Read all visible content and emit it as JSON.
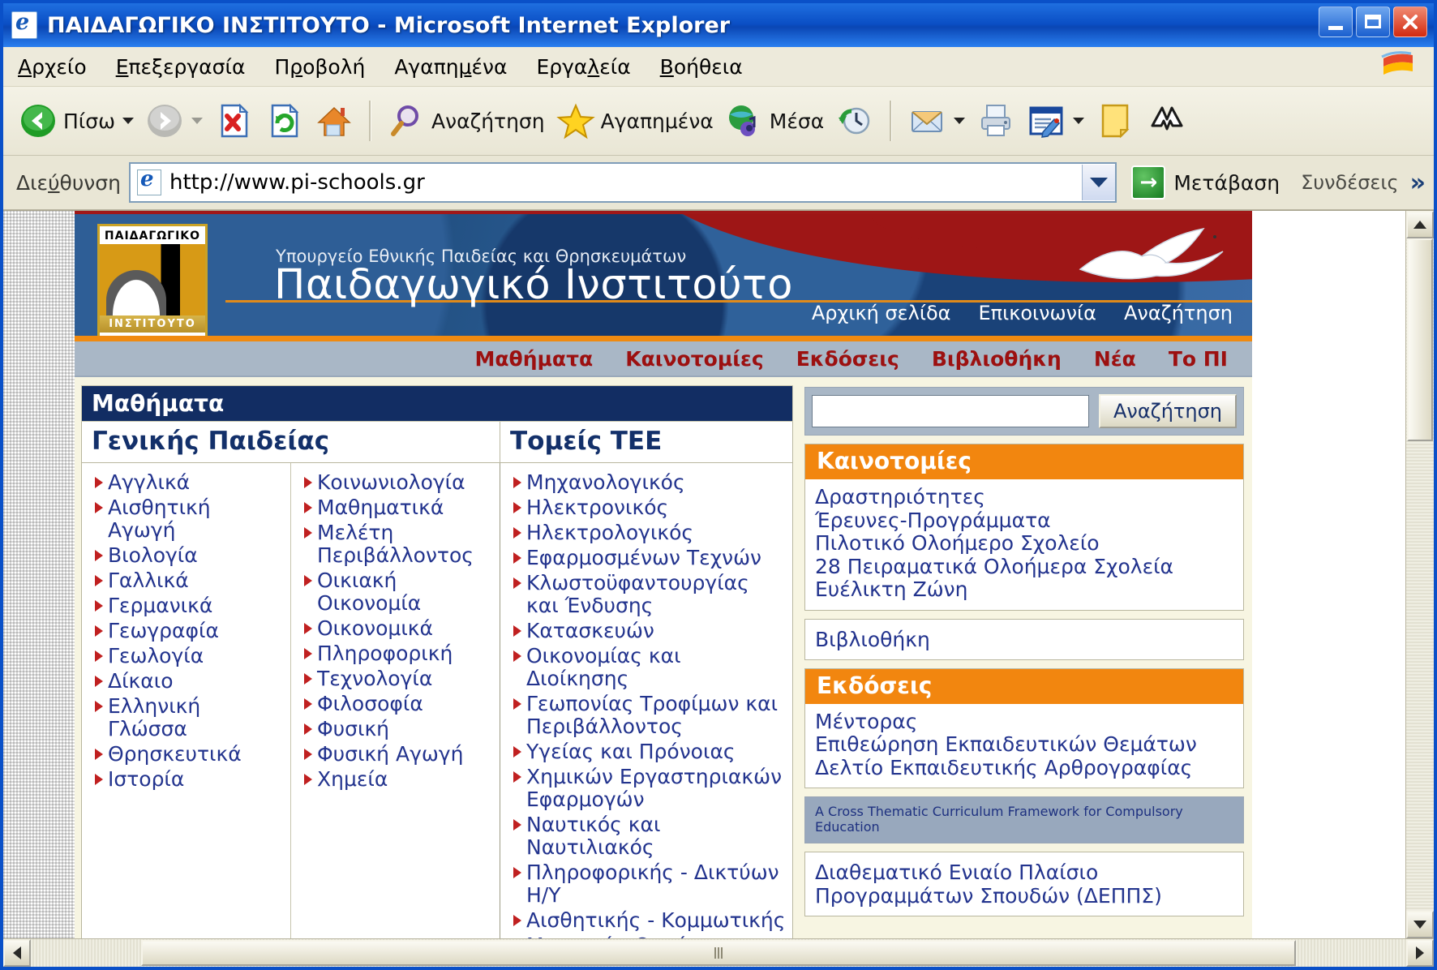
{
  "window": {
    "title": "ΠΑΙΔΑΓΩΓΙΚΟ ΙΝΣΤΙΤΟΥΤΟ - Microsoft Internet Explorer",
    "app_icon": "ie-document-icon",
    "minimize": "–",
    "maximize": "□",
    "close": "✕"
  },
  "menubar": {
    "items": [
      {
        "label": "Αρχείο"
      },
      {
        "label": "Επεξεργασία"
      },
      {
        "label": "Προβολή"
      },
      {
        "label": "Αγαπημένα"
      },
      {
        "label": "Εργαλεία"
      },
      {
        "label": "Βοήθεια"
      }
    ]
  },
  "toolbar": {
    "back_label": "Πίσω",
    "forward_label": "",
    "stop_label": "",
    "refresh_label": "",
    "home_label": "",
    "search_label": "Αναζήτηση",
    "favorites_label": "Αγαπημένα",
    "media_label": "Μέσα",
    "history_label": "",
    "mail_label": "",
    "print_label": "",
    "edit_label": "",
    "notes_label": "",
    "messenger_label": ""
  },
  "address": {
    "label": "Διεύθυνση",
    "url": "http://www.pi-schools.gr",
    "go_label": "Μετάβαση",
    "go_icon": "→",
    "links_label": "Συνδέσεις",
    "more_chevron": "»"
  },
  "site": {
    "logo": {
      "top_text": "ΠΑΙΔΑΓΩΓΙΚΟ",
      "bottom_text": "ΙΝΣΤΙΤΟΥΤΟ"
    },
    "ministry": "Υπουργείο Εθνικής Παιδείας και Θρησκευμάτων",
    "title": "Παιδαγωγικό Ινστιτούτο",
    "topnav": [
      {
        "label": "Αρχική σελίδα"
      },
      {
        "label": "Επικοινωνία"
      },
      {
        "label": "Αναζήτηση"
      }
    ],
    "mainnav": [
      {
        "label": "Μαθήματα"
      },
      {
        "label": "Καινοτομίες"
      },
      {
        "label": "Εκδόσεις"
      },
      {
        "label": "Βιβλιοθήκη"
      },
      {
        "label": "Νέα"
      },
      {
        "label": "Το ΠΙ"
      }
    ]
  },
  "courses": {
    "panel_title": "Μαθήματα",
    "header_general": "Γενικής Παιδείας",
    "header_tee": "Τομείς ΤΕΕ",
    "general_col1": [
      "Αγγλικά",
      "Αισθητική Αγωγή",
      "Βιολογία",
      "Γαλλικά",
      "Γερμανικά",
      "Γεωγραφία",
      "Γεωλογία",
      "Δίκαιο",
      "Ελληνική Γλώσσα",
      "Θρησκευτικά",
      "Ιστορία"
    ],
    "general_col2": [
      "Κοινωνιολογία",
      "Μαθηματικά",
      "Μελέτη Περιβάλλοντος",
      "Οικιακή Οικονομία",
      "Οικονομικά",
      "Πληροφορική",
      "Τεχνολογία",
      "Φιλοσοφία",
      "Φυσική",
      "Φυσική Αγωγή",
      "Χημεία"
    ],
    "tee_col": [
      "Μηχανολογικός",
      "Ηλεκτρονικός",
      "Ηλεκτρολογικός",
      "Εφαρμοσμένων Τεχνών",
      "Κλωστοϋφαντουργίας και Ένδυσης",
      "Κατασκευών",
      "Οικονομίας και Διοίκησης",
      "Γεωπονίας Τροφίμων και Περιβάλλοντος",
      "Υγείας και Πρόνοιας",
      "Χημικών Εργαστηριακών Εφαρμογών",
      "Ναυτικός και Ναυτιλιακός",
      "Πληροφορικής - Δικτύων Η/Υ",
      "Αισθητικής - Κομμωτικής",
      "Μουσικών Οργάνων"
    ]
  },
  "sidebar": {
    "search_value": "",
    "search_button": "Αναζήτηση",
    "innovations": {
      "heading": "Καινοτομίες",
      "links": [
        "Δραστηριότητες",
        "Έρευνες-Προγράμματα",
        "Πιλοτικό Ολοήμερο Σχολείο",
        "28 Πειραματικά Ολοήμερα Σχολεία",
        "Ευέλικτη Ζώνη"
      ]
    },
    "library": {
      "label": "Βιβλιοθήκη"
    },
    "publications": {
      "heading": "Εκδόσεις",
      "links": [
        "Μέντορας",
        "Επιθεώρηση Εκπαιδευτικών Θεμάτων",
        "Δελτίο Εκπαιδευτικής Αρθρογραφίας"
      ]
    },
    "highlight": {
      "line1": "A Cross Thematic Curriculum",
      "line2": "Framework for Compulsory Education"
    },
    "deppa": {
      "line1": "Διαθεματικό Ενιαίο Πλαίσιο",
      "line2": "Προγραμμάτων Σπουδών (ΔΕΠΠΣ)"
    }
  },
  "colors": {
    "title_blue": "#0a4ec4",
    "banner_blue": "#1f4e86",
    "banner_red": "#9e1616",
    "accent_orange": "#f2860f",
    "link_blue": "#23348e",
    "nav_red": "#9c1010",
    "panel_navy": "#122d63"
  }
}
